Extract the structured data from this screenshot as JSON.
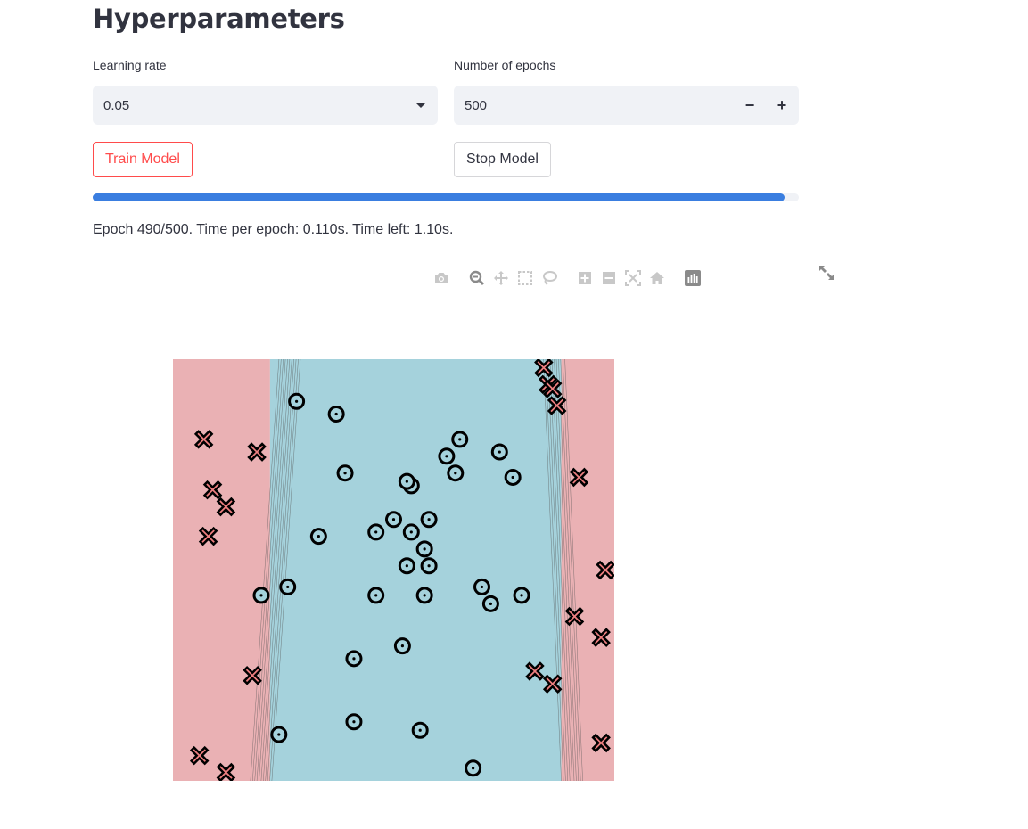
{
  "section": {
    "title": "Hyperparameters"
  },
  "learning_rate": {
    "label": "Learning rate",
    "value": "0.05"
  },
  "epochs": {
    "label": "Number of epochs",
    "value": "500",
    "decrement": "−",
    "increment": "+"
  },
  "buttons": {
    "train": "Train Model",
    "stop": "Stop Model"
  },
  "progress": {
    "percent": 98
  },
  "status": {
    "text": "Epoch 490/500. Time per epoch: 0.110s. Time left: 1.10s."
  },
  "colors": {
    "accent": "#ff4b4b",
    "progress": "#3a7ee0",
    "class_region_inner": "#a5d2dc",
    "class_region_outer": "#eab1b4",
    "cross": "#ee7f80"
  },
  "icons": [
    "camera-icon",
    "zoom-icon",
    "pan-icon",
    "box-select-icon",
    "lasso-select-icon",
    "zoom-in-icon",
    "zoom-out-icon",
    "autoscale-icon",
    "reset-axes-icon",
    "plotly-logo-icon",
    "fullscreen-icon"
  ],
  "chart_data": {
    "type": "scatter",
    "title": "",
    "xlabel": "",
    "ylabel": "",
    "xlim": [
      0,
      1
    ],
    "ylim": [
      0,
      1
    ],
    "grid": false,
    "regions": [
      {
        "class": "cross",
        "range": [
          0,
          0.22
        ]
      },
      {
        "class": "circle",
        "range": [
          0.22,
          0.88
        ]
      },
      {
        "class": "cross",
        "range": [
          0.88,
          1
        ]
      }
    ],
    "series": [
      {
        "marker": "cross",
        "points": [
          [
            0.84,
            0.98
          ],
          [
            0.85,
            0.94
          ],
          [
            0.86,
            0.93
          ],
          [
            0.87,
            0.89
          ],
          [
            0.07,
            0.81
          ],
          [
            0.19,
            0.78
          ],
          [
            0.92,
            0.72
          ],
          [
            0.09,
            0.69
          ],
          [
            0.12,
            0.65
          ],
          [
            0.08,
            0.58
          ],
          [
            0.98,
            0.5
          ],
          [
            0.91,
            0.39
          ],
          [
            0.97,
            0.34
          ],
          [
            0.18,
            0.25
          ],
          [
            0.82,
            0.26
          ],
          [
            0.86,
            0.23
          ],
          [
            0.97,
            0.09
          ],
          [
            0.06,
            0.06
          ],
          [
            0.12,
            0.02
          ]
        ]
      },
      {
        "marker": "circle",
        "points": [
          [
            0.28,
            0.9
          ],
          [
            0.37,
            0.87
          ],
          [
            0.65,
            0.81
          ],
          [
            0.62,
            0.77
          ],
          [
            0.74,
            0.78
          ],
          [
            0.39,
            0.73
          ],
          [
            0.64,
            0.73
          ],
          [
            0.77,
            0.72
          ],
          [
            0.54,
            0.7
          ],
          [
            0.53,
            0.71
          ],
          [
            0.5,
            0.62
          ],
          [
            0.58,
            0.62
          ],
          [
            0.46,
            0.59
          ],
          [
            0.54,
            0.59
          ],
          [
            0.33,
            0.58
          ],
          [
            0.57,
            0.55
          ],
          [
            0.53,
            0.51
          ],
          [
            0.58,
            0.51
          ],
          [
            0.26,
            0.46
          ],
          [
            0.7,
            0.46
          ],
          [
            0.2,
            0.44
          ],
          [
            0.46,
            0.44
          ],
          [
            0.57,
            0.44
          ],
          [
            0.79,
            0.44
          ],
          [
            0.72,
            0.42
          ],
          [
            0.52,
            0.32
          ],
          [
            0.41,
            0.29
          ],
          [
            0.41,
            0.14
          ],
          [
            0.24,
            0.11
          ],
          [
            0.56,
            0.12
          ],
          [
            0.68,
            0.03
          ]
        ]
      }
    ]
  }
}
